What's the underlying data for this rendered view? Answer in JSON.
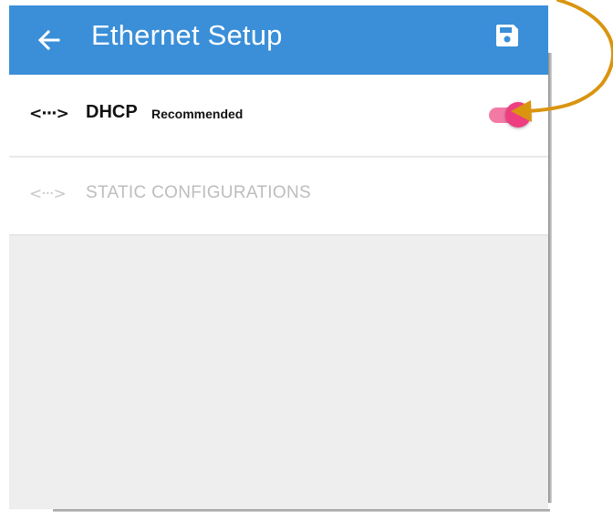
{
  "appbar": {
    "title": "Ethernet Setup",
    "back_icon": "arrow-left-icon",
    "save_icon": "floppy-disk-icon",
    "color": "#3a8fd8"
  },
  "options": {
    "dhcp": {
      "icon_glyph": "<···>",
      "icon": "ethernet-icon",
      "label": "DHCP",
      "sublabel": "Recommended",
      "enabled": true
    },
    "static": {
      "icon_glyph": "<···>",
      "icon": "ethernet-icon",
      "label": "STATIC CONFIGURATIONS",
      "enabled": false
    }
  },
  "toggle": {
    "state": "on",
    "track_color": "#f47aa6",
    "thumb_color": "#ee3d80"
  },
  "annotation": {
    "arrow_color": "#d9950f",
    "points_to": "dhcp-toggle"
  }
}
